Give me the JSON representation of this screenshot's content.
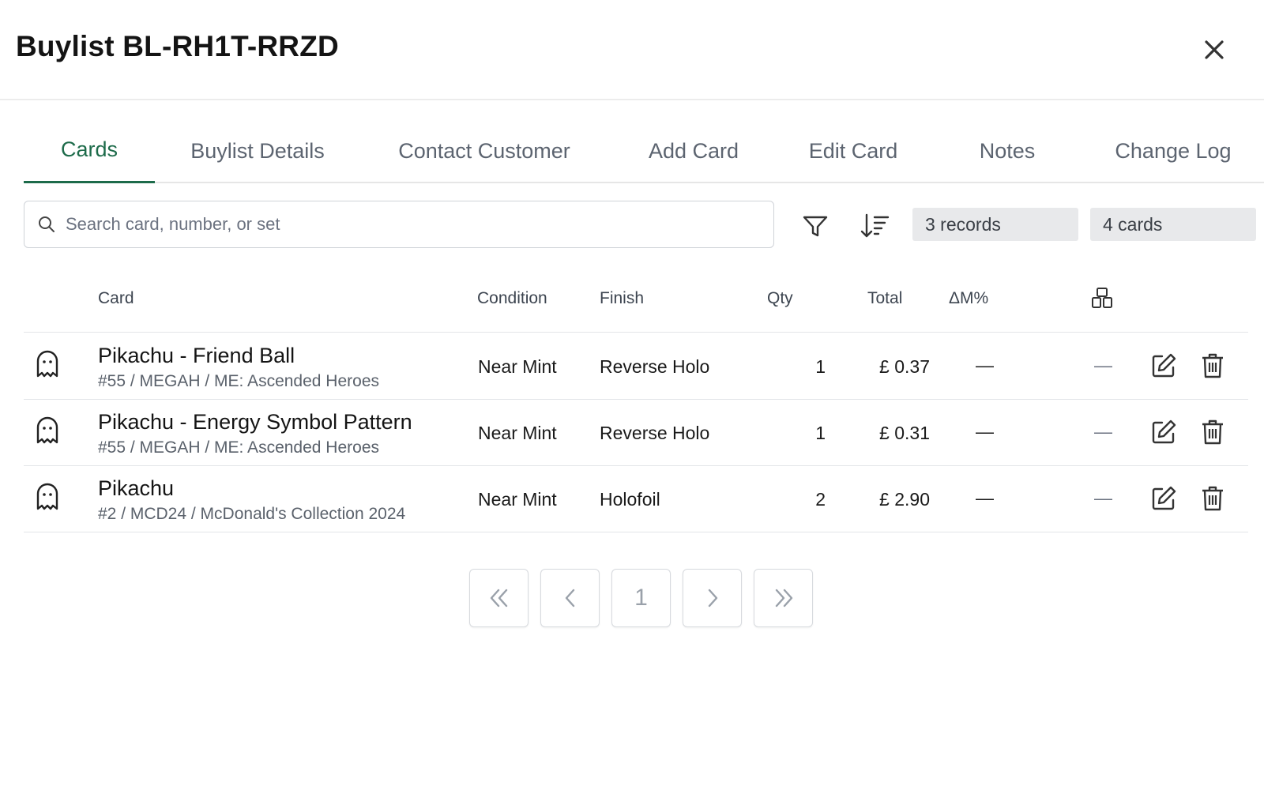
{
  "modal": {
    "title": "Buylist BL-RH1T-RRZD",
    "close_icon": "close-icon"
  },
  "tabs": [
    {
      "label": "Cards",
      "active": true
    },
    {
      "label": "Buylist Details"
    },
    {
      "label": "Contact Customer"
    },
    {
      "label": "Add Card"
    },
    {
      "label": "Edit Card"
    },
    {
      "label": "Notes"
    },
    {
      "label": "Change Log"
    }
  ],
  "toolbar": {
    "search_placeholder": "Search card, number, or set",
    "search_value": "",
    "records_badge": "3 records",
    "cards_badge": "4 cards"
  },
  "table": {
    "headers": {
      "card": "Card",
      "condition": "Condition",
      "finish": "Finish",
      "qty": "Qty",
      "total": "Total",
      "delta": "ΔM%"
    },
    "rows": [
      {
        "name": "Pikachu - Friend Ball",
        "details": "#55 / MEGAH / ME: Ascended Heroes",
        "condition": "Near Mint",
        "finish": "Reverse Holo",
        "qty": "1",
        "total": "£ 0.37",
        "delta": "—",
        "pinned": "—"
      },
      {
        "name": "Pikachu - Energy Symbol Pattern",
        "details": "#55 / MEGAH / ME: Ascended Heroes",
        "condition": "Near Mint",
        "finish": "Reverse Holo",
        "qty": "1",
        "total": "£ 0.31",
        "delta": "—",
        "pinned": "—"
      },
      {
        "name": "Pikachu",
        "details": "#2 / MCD24 / McDonald's Collection 2024",
        "condition": "Near Mint",
        "finish": "Holofoil",
        "qty": "2",
        "total": "£ 2.90",
        "delta": "—",
        "pinned": "—"
      }
    ]
  },
  "pagination": {
    "current_page": "1"
  },
  "colors": {
    "accent": "#1d6b4a",
    "badge_bg": "#e8e9eb",
    "border": "#cfd3d8"
  }
}
